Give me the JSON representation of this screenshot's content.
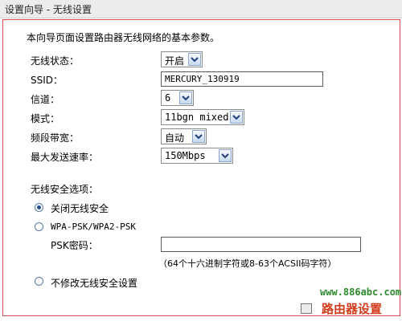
{
  "window": {
    "title": "设置向导 - 无线设置"
  },
  "intro": "本向导页面设置路由器无线网络的基本参数。",
  "fields": {
    "wireless_status": {
      "label": "无线状态：",
      "value": "开启"
    },
    "ssid": {
      "label": "SSID：",
      "value": "MERCURY_130919"
    },
    "channel": {
      "label": "信道：",
      "value": "6"
    },
    "mode": {
      "label": "模式：",
      "value": "11bgn mixed"
    },
    "bandwidth": {
      "label": "频段带宽：",
      "value": "自动"
    },
    "max_rate": {
      "label": "最大发送速率：",
      "value": "150Mbps"
    }
  },
  "security": {
    "heading": "无线安全选项：",
    "options": [
      {
        "label": "关闭无线安全",
        "selected": true
      },
      {
        "label": "WPA-PSK/WPA2-PSK",
        "selected": false
      },
      {
        "label": "不修改无线安全设置",
        "selected": false
      }
    ],
    "psk_label": "PSK密码：",
    "psk_value": "",
    "psk_hint": "（64个十六进制字符或8-63个ACSII码字符）"
  },
  "watermark": {
    "url": "www.886abc.com",
    "brand": "路由器设置"
  },
  "colors": {
    "frame_border": "#d44a4a",
    "watermark_url": "#2c8a2c",
    "watermark_brand": "#d23a1a"
  }
}
